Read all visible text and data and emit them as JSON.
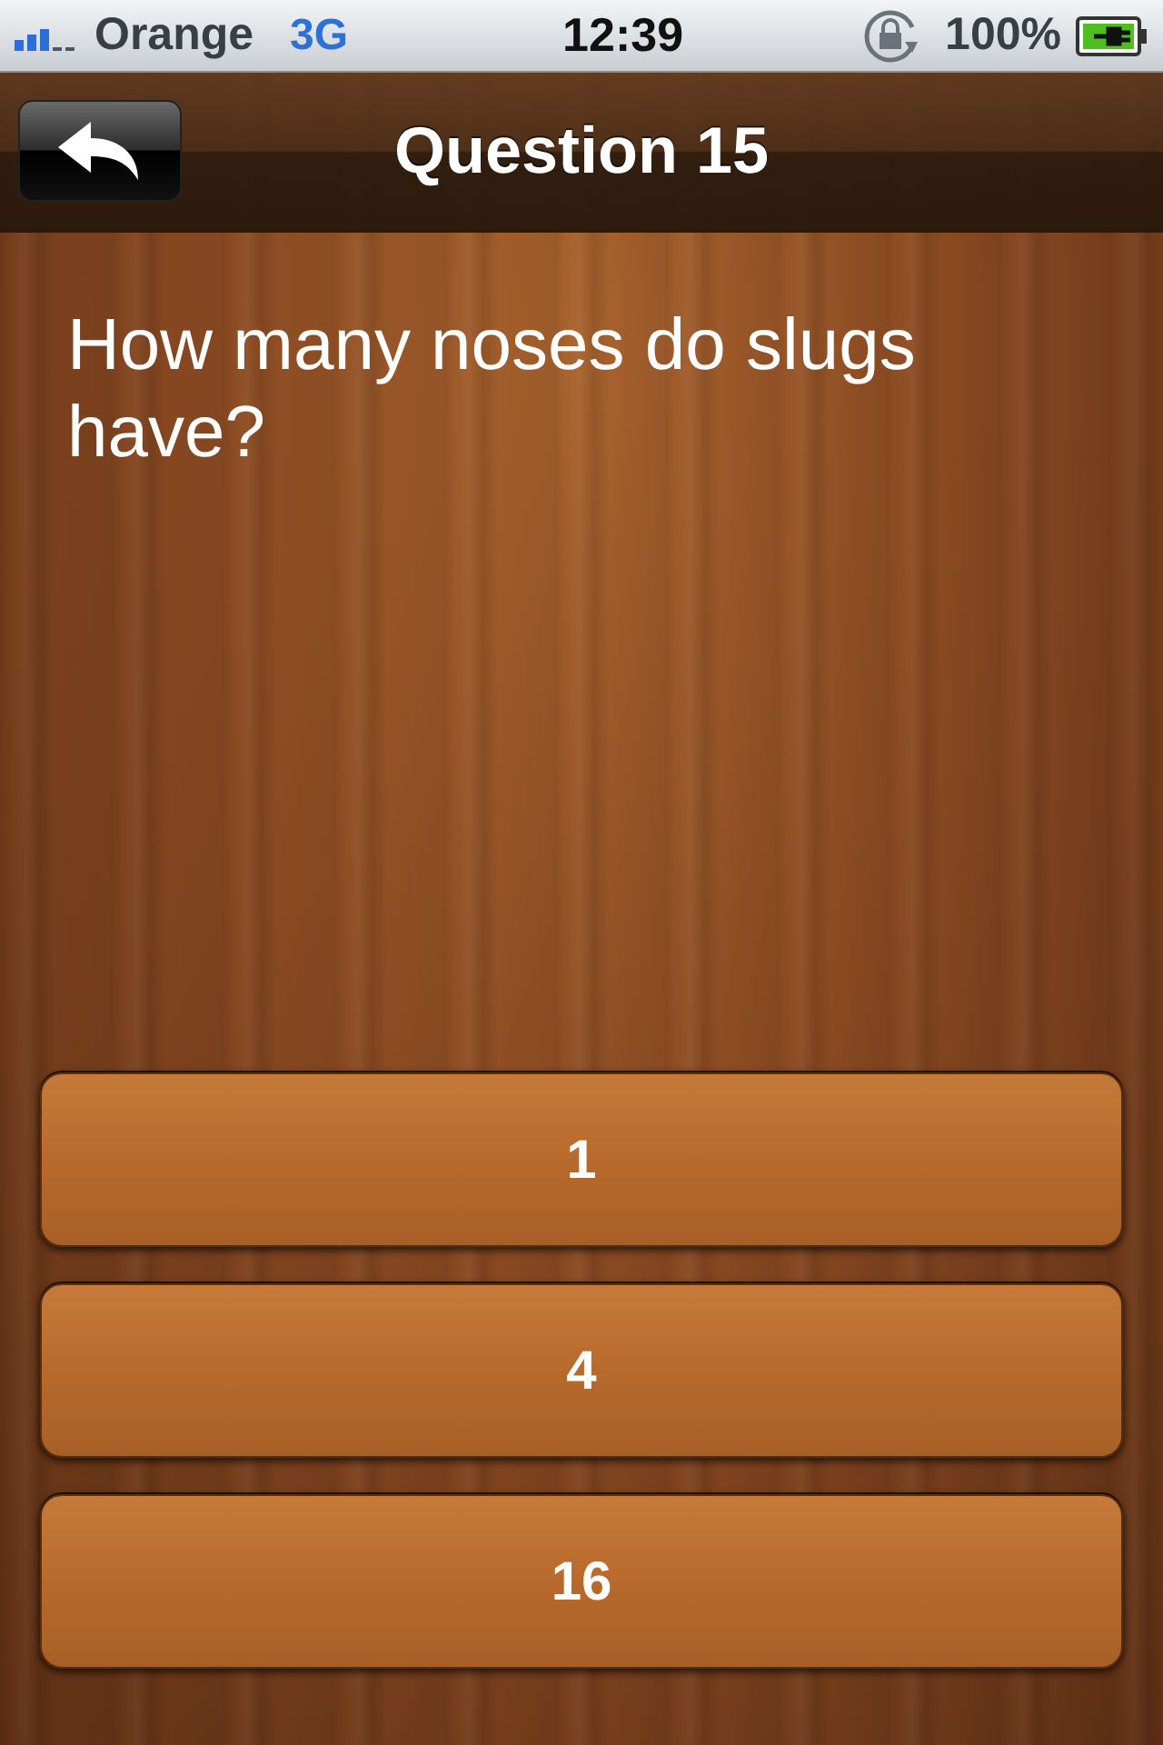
{
  "status_bar": {
    "carrier": "Orange",
    "network": "3G",
    "time": "12:39",
    "battery": "100%"
  },
  "nav_bar": {
    "title": "Question 15"
  },
  "question": "How many noses do slugs have?",
  "answers": [
    {
      "label": "1"
    },
    {
      "label": "4"
    },
    {
      "label": "16"
    }
  ]
}
